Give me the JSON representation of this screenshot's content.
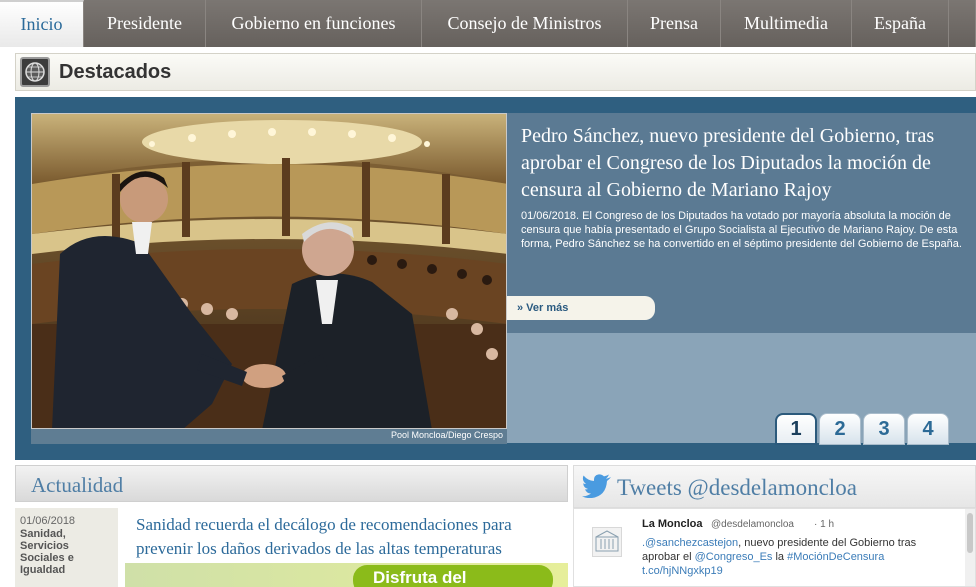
{
  "nav": {
    "items": [
      {
        "label": "Inicio",
        "active": true
      },
      {
        "label": "Presidente"
      },
      {
        "label": "Gobierno en funciones"
      },
      {
        "label": "Consejo de Ministros"
      },
      {
        "label": "Prensa"
      },
      {
        "label": "Multimedia"
      },
      {
        "label": "España"
      }
    ]
  },
  "destacados": {
    "title": "Destacados",
    "icon": "globe-icon"
  },
  "feature": {
    "title": "Pedro Sánchez, nuevo presidente del Gobierno, tras aprobar el Congreso de los Diputados la moción de censura al Gobierno de Mariano Rajoy",
    "summary": "01/06/2018. El Congreso de los Diputados ha votado por mayoría absoluta la moción de censura que había presentado el Grupo Socialista al Ejecutivo de Mariano Rajoy. De esta forma, Pedro Sánchez se ha convertido en el séptimo presidente del Gobierno de España.",
    "more_label": "» Ver más",
    "photo_credit": "Pool Moncloa/Diego Crespo",
    "pages": [
      "1",
      "2",
      "3",
      "4"
    ],
    "active_page": "1"
  },
  "actualidad": {
    "title": "Actualidad",
    "date": "01/06/2018",
    "category": "Sanidad, Servicios Sociales e Igualdad",
    "headline": "Sanidad recuerda el decálogo de recomendaciones para prevenir los daños derivados de las altas temperaturas",
    "banner_text": "Disfruta del"
  },
  "tweets": {
    "title": "Tweets @desdelamoncloa",
    "icon": "twitter-bird-icon",
    "author": "La Moncloa",
    "handle": "@desdelamoncloa",
    "time": "· 1 h",
    "text_prefix": ".@sanchezcastejon",
    "text_mid": ", nuevo presidente del Gobierno tras aprobar el ",
    "mention": "@Congreso_Es",
    "text_la": " la ",
    "hashtag": "#MociónDeCensura",
    "link": "t.co/hjNNgxkp19"
  },
  "colors": {
    "nav_bg": "#6f6a66",
    "feature_bg": "#2f5f80",
    "accent_blue": "#2c6a9a"
  }
}
